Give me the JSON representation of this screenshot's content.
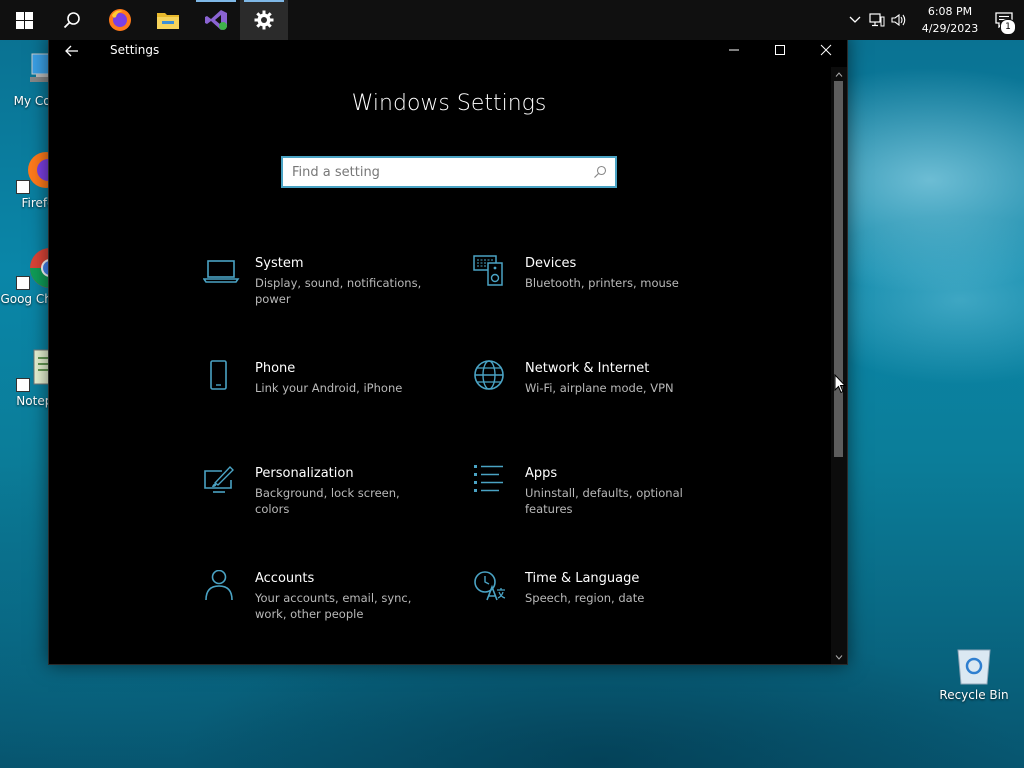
{
  "taskbar": {
    "apps": [
      {
        "name": "start"
      },
      {
        "name": "search"
      },
      {
        "name": "firefox"
      },
      {
        "name": "file-explorer"
      },
      {
        "name": "visual-studio"
      },
      {
        "name": "settings"
      }
    ],
    "clock": {
      "time": "6:08 PM",
      "date": "4/29/2023"
    },
    "notifications_count": "1"
  },
  "desktop": {
    "icons": [
      {
        "label": "My Com"
      },
      {
        "label": "Firefo"
      },
      {
        "label": "Goog Chrom"
      },
      {
        "label": "Notepa"
      },
      {
        "label": "Recycle Bin"
      }
    ]
  },
  "window": {
    "title": "Settings",
    "heading": "Windows Settings",
    "search_placeholder": "Find a setting",
    "categories": [
      {
        "name": "System",
        "desc": "Display, sound, notifications, power"
      },
      {
        "name": "Devices",
        "desc": "Bluetooth, printers, mouse"
      },
      {
        "name": "Phone",
        "desc": "Link your Android, iPhone"
      },
      {
        "name": "Network & Internet",
        "desc": "Wi-Fi, airplane mode, VPN"
      },
      {
        "name": "Personalization",
        "desc": "Background, lock screen, colors"
      },
      {
        "name": "Apps",
        "desc": "Uninstall, defaults, optional features"
      },
      {
        "name": "Accounts",
        "desc": "Your accounts, email, sync, work, other people"
      },
      {
        "name": "Time & Language",
        "desc": "Speech, region, date"
      }
    ]
  },
  "colors": {
    "accent": "#4aa3c4",
    "window_bg": "#000000",
    "taskbar_bg": "#101010"
  }
}
